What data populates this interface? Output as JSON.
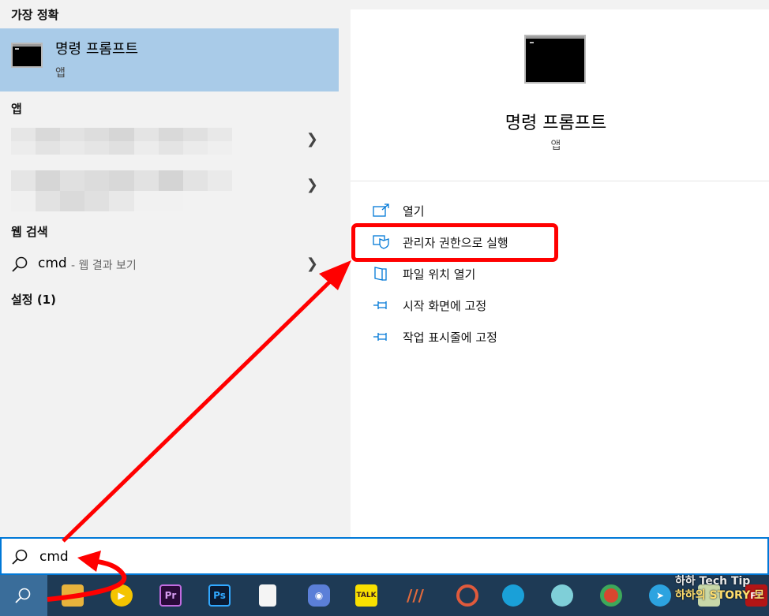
{
  "left": {
    "best_match_heading": "가장 정확",
    "best_match": {
      "title": "명령 프롬프트",
      "subtitle": "앱"
    },
    "apps_heading": "앱",
    "web_heading": "웹 검색",
    "web_result": {
      "term": "cmd",
      "desc": "- 웹 결과 보기"
    },
    "settings_heading": "설정 (1)"
  },
  "right": {
    "title": "명령 프롬프트",
    "subtitle": "앱",
    "actions": [
      {
        "label": "열기",
        "icon": "open-icon"
      },
      {
        "label": "관리자 권한으로 실행",
        "icon": "run-as-admin-icon"
      },
      {
        "label": "파일 위치 열기",
        "icon": "file-location-icon"
      },
      {
        "label": "시작 화면에 고정",
        "icon": "pin-icon"
      },
      {
        "label": "작업 표시줄에 고정",
        "icon": "pin-icon"
      }
    ]
  },
  "search": {
    "value": "cmd"
  },
  "taskbar": {
    "icons": [
      {
        "name": "file-explorer-icon",
        "text": ""
      },
      {
        "name": "media-player-icon",
        "text": ""
      },
      {
        "name": "premiere-icon",
        "text": "Pr"
      },
      {
        "name": "photoshop-icon",
        "text": "Ps"
      },
      {
        "name": "file-icon",
        "text": ""
      },
      {
        "name": "camera-app-icon",
        "text": ""
      },
      {
        "name": "kakaotalk-icon",
        "text": "TALK"
      },
      {
        "name": "app-icon",
        "text": ""
      },
      {
        "name": "recorder-icon",
        "text": ""
      },
      {
        "name": "edge-icon",
        "text": ""
      },
      {
        "name": "app-icon",
        "text": ""
      },
      {
        "name": "chrome-icon",
        "text": ""
      },
      {
        "name": "telegram-icon",
        "text": ""
      },
      {
        "name": "app-icon",
        "text": ""
      },
      {
        "name": "filezilla-icon",
        "text": "FZ"
      }
    ],
    "watermark_line1": "하하 Tech Tip",
    "watermark_line2": "하하의 STORY 모"
  },
  "colors": {
    "selection": "#a9cbe8",
    "accent": "#0078d7",
    "annotation": "#ff0000",
    "taskbar": "#1e3a55"
  }
}
